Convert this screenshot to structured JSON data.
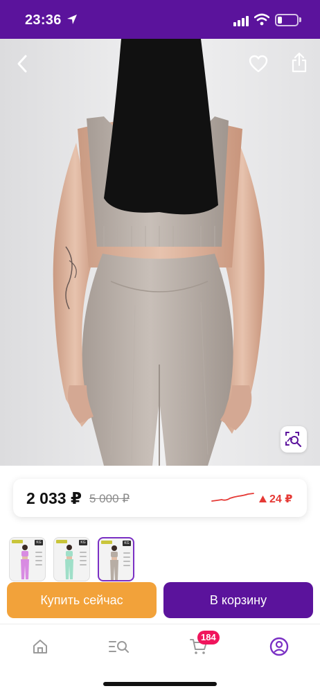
{
  "status_bar": {
    "time": "23:36",
    "battery_level": 0.22,
    "background_color": "#5b139c"
  },
  "product_image": {
    "icons": [
      "chevron-left-icon",
      "heart-icon",
      "share-icon",
      "image-search-icon"
    ]
  },
  "price": {
    "current": "2 033 ₽",
    "old": "5 000 ₽",
    "change": "24 ₽",
    "change_direction": "up",
    "change_color": "#e53935"
  },
  "thumbnails": [
    {
      "product_color": "#d88be2",
      "active": false
    },
    {
      "product_color": "#9fdfc8",
      "active": false
    },
    {
      "product_color": "#b7ada4",
      "active": true
    }
  ],
  "actions": {
    "buy_now": "Купить сейчас",
    "add_to_cart": "В корзину",
    "buy_color": "#f2a23a",
    "cart_color": "#5b139c"
  },
  "bottom_nav": {
    "items": [
      "home",
      "catalog",
      "cart",
      "profile"
    ],
    "active": "profile",
    "cart_count": "184",
    "accent_color": "#7a2fc4",
    "badge_color": "#f0155c"
  }
}
